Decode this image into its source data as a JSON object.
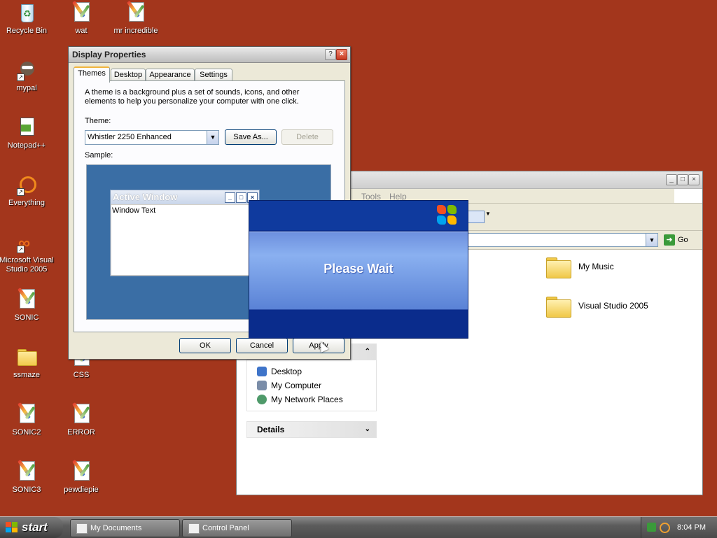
{
  "desktop": {
    "icons": [
      {
        "label": "Recycle Bin",
        "icon": "recycle-bin-icon"
      },
      {
        "label": "wat",
        "icon": "paint-document-icon"
      },
      {
        "label": "mr incredible",
        "icon": "paint-document-icon"
      },
      {
        "label": "mypal",
        "icon": "mypal-browser-icon"
      },
      {
        "label": "Notepad++",
        "icon": "notepadpp-icon"
      },
      {
        "label": "Everything",
        "icon": "everything-search-icon"
      },
      {
        "label": "Microsoft Visual Studio 2005",
        "icon": "visual-studio-icon"
      },
      {
        "label": "SONIC",
        "icon": "paint-document-icon"
      },
      {
        "label": "ssmaze",
        "icon": "folder-icon"
      },
      {
        "label": "CSS",
        "icon": "paint-document-icon"
      },
      {
        "label": "SONIC2",
        "icon": "paint-document-icon"
      },
      {
        "label": "ERROR",
        "icon": "paint-document-icon"
      },
      {
        "label": "SONIC3",
        "icon": "paint-document-icon"
      },
      {
        "label": "pewdiepie",
        "icon": "paint-document-icon"
      }
    ]
  },
  "explorer": {
    "menu": {
      "tools": "Tools",
      "help": "Help"
    },
    "go_label": "Go",
    "task_pane": {
      "other_places_links": [
        "Desktop",
        "My Computer",
        "My Network Places"
      ],
      "details_label": "Details"
    },
    "items": [
      "My Music",
      "Visual Studio 2005"
    ]
  },
  "dialog": {
    "title": "Display Properties",
    "help_glyph": "?",
    "close_glyph": "×",
    "tabs": [
      "Themes",
      "Desktop",
      "Appearance",
      "Settings"
    ],
    "description": "A theme is a background plus a set of sounds, icons, and other elements to help you personalize your computer with one click.",
    "theme_label": "Theme:",
    "theme_value": "Whistler 2250 Enhanced",
    "save_as": "Save As...",
    "delete": "Delete",
    "sample_label": "Sample:",
    "sample_window": {
      "title": "Active Window",
      "text": "Window Text"
    },
    "ok": "OK",
    "cancel": "Cancel",
    "apply": "Apply"
  },
  "wait_dialog": {
    "message": "Please Wait"
  },
  "taskbar": {
    "start": "start",
    "tasks": [
      "My Documents",
      "Control Panel"
    ],
    "clock": "8:04 PM"
  }
}
